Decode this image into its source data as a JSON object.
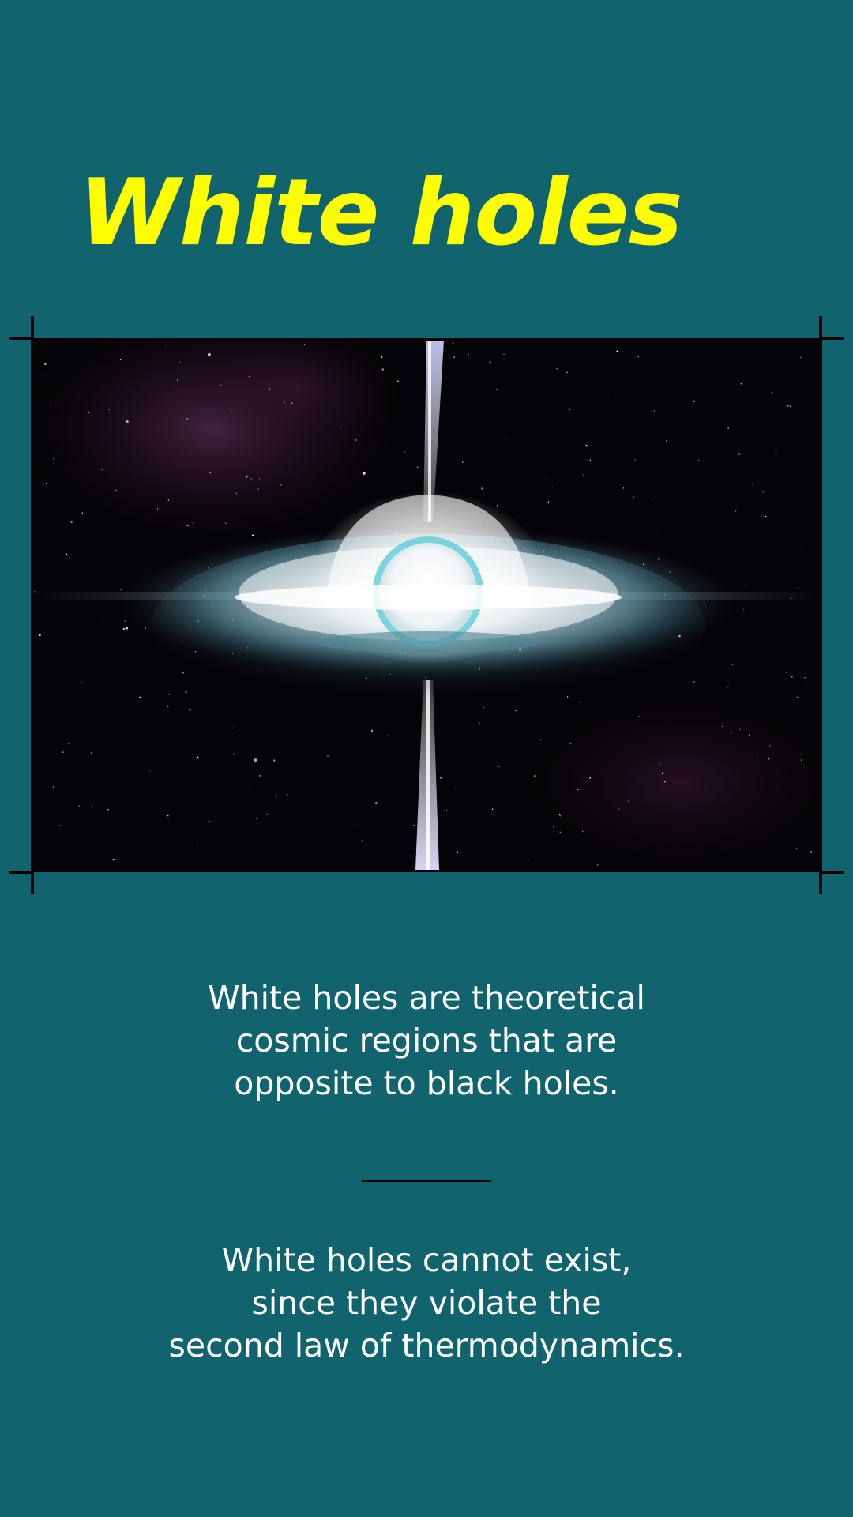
{
  "title": "White holes",
  "image": {
    "subject": "white-hole-accretion-disk-illustration"
  },
  "paragraphs": [
    "White holes are theoretical\ncosmic regions that are\nopposite to black holes.",
    "White holes cannot exist,\nsince they violate the\nsecond law of thermodynamics."
  ],
  "colors": {
    "background": "#11636d",
    "title": "#ffff00",
    "text": "#ffffff"
  }
}
